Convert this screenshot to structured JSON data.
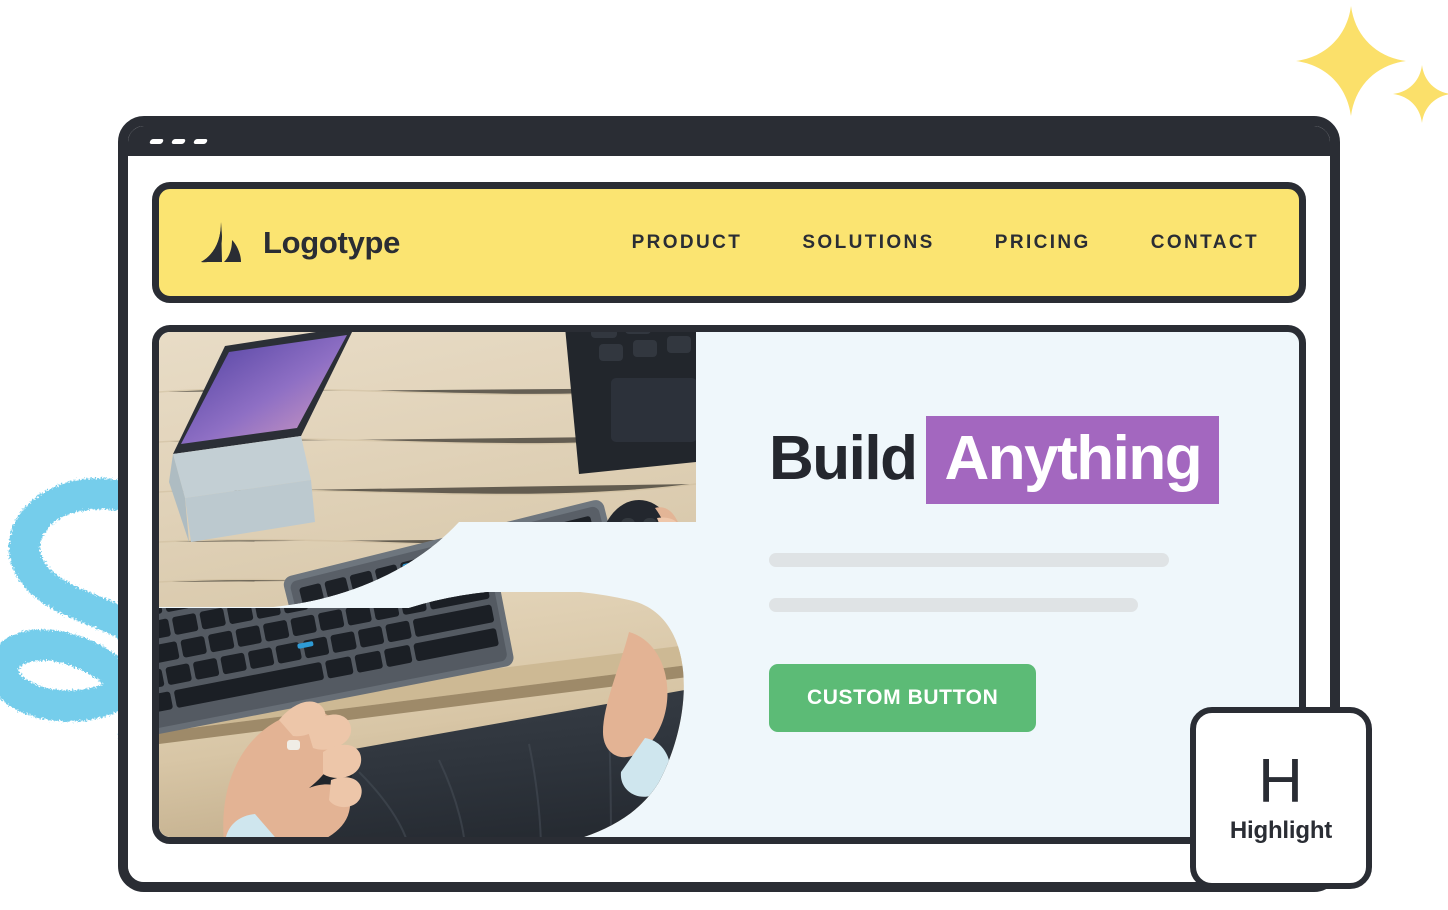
{
  "window": {
    "title_bar_dots": [
      "dot-1",
      "dot-2",
      "dot-3"
    ]
  },
  "navbar": {
    "logo_icon": "logotype-mark-icon",
    "brand": "Logotype",
    "links": [
      {
        "label": "PRODUCT"
      },
      {
        "label": "SOLUTIONS"
      },
      {
        "label": "PRICING"
      },
      {
        "label": "CONTACT"
      }
    ]
  },
  "hero": {
    "headline_plain": "Build",
    "headline_highlight": "Anything",
    "body_placeholder_lines": 2,
    "cta_label": "CUSTOM BUTTON",
    "media": {
      "top_photo_alt": "desk-with-keyboard-laptop-and-mouse",
      "bottom_photo_alt": "hands-typing-on-keyboard-at-desk"
    }
  },
  "highlight_card": {
    "letter": "H",
    "label": "Highlight"
  },
  "decorations": {
    "sparkle_large": "sparkle-icon",
    "sparkle_small": "sparkle-icon",
    "squiggle": "blue-brush-squiggle",
    "burst": "dark-speckled-burst"
  },
  "colors": {
    "ink": "#2A2D34",
    "nav_yellow": "#FBE471",
    "hero_bg": "#EFF7FB",
    "highlight_purple": "#A367BF",
    "cta_green": "#5CBB76",
    "placeholder_gray": "#DFE3E5",
    "sparkle_yellow": "#FBE06A",
    "squiggle_blue": "#74CDEB"
  }
}
